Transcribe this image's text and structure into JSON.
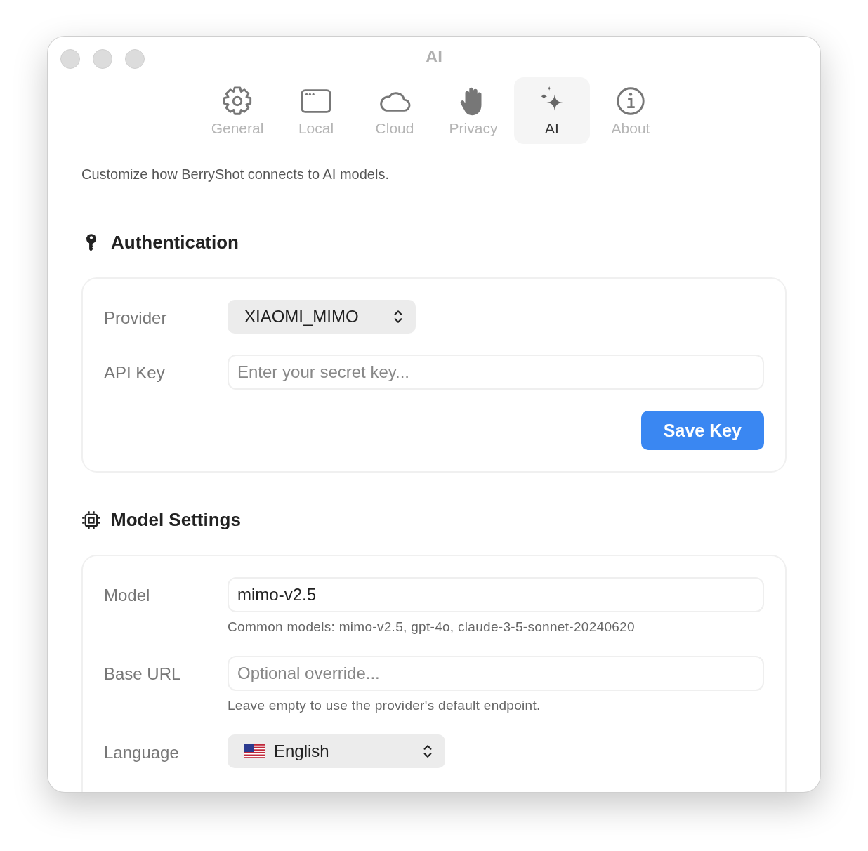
{
  "window": {
    "title": "AI"
  },
  "tabs": [
    {
      "label": "General",
      "selected": false
    },
    {
      "label": "Local",
      "selected": false
    },
    {
      "label": "Cloud",
      "selected": false
    },
    {
      "label": "Privacy",
      "selected": false
    },
    {
      "label": "AI",
      "selected": true
    },
    {
      "label": "About",
      "selected": false
    }
  ],
  "description": "Customize how BerryShot connects to AI models.",
  "sections": [
    {
      "title": "Authentication",
      "rows": [
        {
          "kind": "select",
          "label": "Provider",
          "value": "XIAOMI_MIMO"
        },
        {
          "kind": "input",
          "label": "API Key",
          "placeholder": "Enter your secret key..."
        }
      ],
      "button": "Save Key"
    },
    {
      "title": "Model Settings",
      "rows": [
        {
          "kind": "input",
          "label": "Model",
          "value": "mimo-v2.5",
          "hint": "Common models: mimo-v2.5, gpt-4o, claude-3-5-sonnet-20240620"
        },
        {
          "kind": "input",
          "label": "Base URL",
          "placeholder": "Optional override...",
          "hint": "Leave empty to use the provider's default endpoint."
        },
        {
          "kind": "flag-select",
          "label": "Language",
          "value": "English"
        }
      ]
    }
  ]
}
